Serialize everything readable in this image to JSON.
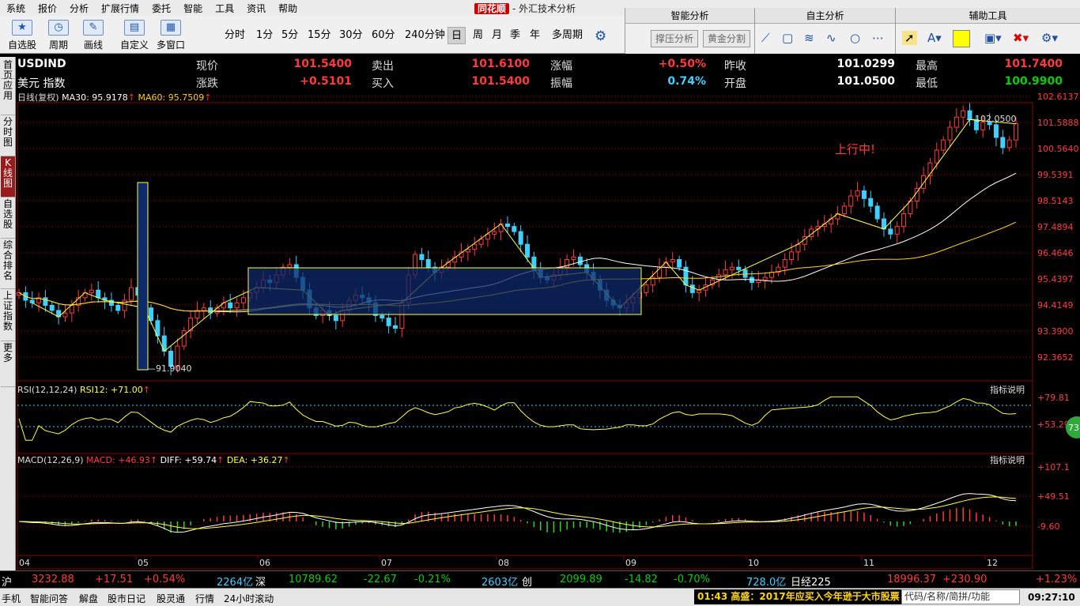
{
  "menu": [
    "系统",
    "报价",
    "分析",
    "扩展行情",
    "委托",
    "智能",
    "工具",
    "资讯",
    "帮助"
  ],
  "app_title": {
    "logo": "同花顺",
    "subtitle": "- 外汇技术分析"
  },
  "toolbar": {
    "buttons": [
      "自选股",
      "周期",
      "画线",
      "自定义",
      "多窗口"
    ],
    "periods": [
      "分时",
      "1分",
      "5分",
      "15分",
      "30分",
      "60分",
      "240分钟",
      "日",
      "周",
      "月",
      "季",
      "年",
      "多周期"
    ],
    "selected_period": "日"
  },
  "right_panels": {
    "smart": {
      "title": "智能分析",
      "btns": [
        "撑压分析",
        "黄金分割"
      ]
    },
    "self": {
      "title": "自主分析"
    },
    "aux": {
      "title": "辅助工具"
    }
  },
  "left_tabs": [
    "首页",
    "应用",
    "分时图",
    "K线图",
    "自选股",
    "综合排名",
    "上证指数",
    "更多"
  ],
  "selected_tab": "K线图",
  "quote": {
    "symbol": "USDIND",
    "name": "美元 指数",
    "rows": [
      [
        {
          "k": "现价",
          "v": "101.5400"
        },
        {
          "k": "卖出",
          "v": "101.6100"
        },
        {
          "k": "涨幅",
          "v": "+0.50%"
        },
        {
          "k": "昨收",
          "v": "101.0299"
        },
        {
          "k": "最高",
          "v": "101.7400"
        }
      ],
      [
        {
          "k": "涨跌",
          "v": "+0.5101"
        },
        {
          "k": "买入",
          "v": "101.5400"
        },
        {
          "k": "振幅",
          "v": "0.74%"
        },
        {
          "k": "开盘",
          "v": "101.0500"
        },
        {
          "k": "最低",
          "v": "100.9900"
        }
      ]
    ]
  },
  "chart_data": {
    "type": "candlestick",
    "header": {
      "label": "日线(复权)",
      "ma30": "MA30: 95.9178",
      "ma60": "MA60: 95.7509"
    },
    "price_ticks": [
      "102.6137",
      "101.5888",
      "100.5640",
      "99.5391",
      "98.5143",
      "97.4894",
      "96.4646",
      "95.4397",
      "94.4149",
      "93.3900",
      "92.3652"
    ],
    "ylim": [
      92.3652,
      102.6137
    ],
    "annotation": "上行中!",
    "high_label": "102.0500",
    "low_label": "91.9040",
    "x_labels": [
      "04",
      "05",
      "06",
      "07",
      "08",
      "09",
      "10",
      "11",
      "12"
    ],
    "rsi": {
      "label": "RSI(12,12,24)",
      "value": "RSI12: +71.00",
      "ticks": [
        "+79.81",
        "+53.29"
      ],
      "badge": "73"
    },
    "macd": {
      "label": "MACD(12,26,9)",
      "macd": "MACD: +46.93",
      "diff": "DIFF: +59.74",
      "dea": "DEA: +36.27",
      "ticks": [
        "+107.1",
        "+49.51",
        "-9.60"
      ]
    },
    "indicator_help": "指标说明",
    "closes": [
      94.9,
      94.6,
      94.5,
      94.7,
      94.4,
      94.2,
      93.95,
      94.1,
      94.4,
      94.7,
      94.9,
      95.0,
      94.7,
      94.6,
      94.4,
      94.2,
      94.6,
      95.1,
      94.8,
      94.3,
      93.8,
      93.2,
      92.6,
      92.0,
      92.8,
      93.4,
      93.9,
      94.2,
      94.3,
      94.1,
      94.3,
      94.5,
      94.3,
      94.5,
      94.7,
      94.9,
      95.1,
      95.4,
      95.3,
      95.6,
      95.9,
      96.0,
      95.5,
      95.0,
      94.3,
      94.0,
      94.2,
      94.0,
      93.8,
      94.2,
      94.6,
      94.8,
      94.7,
      94.5,
      94.0,
      93.9,
      93.6,
      93.5,
      94.5,
      95.6,
      96.4,
      96.2,
      95.9,
      95.7,
      95.9,
      96.1,
      96.3,
      96.5,
      96.6,
      96.8,
      97.0,
      97.2,
      97.3,
      97.6,
      97.5,
      97.3,
      96.8,
      96.3,
      95.8,
      95.5,
      95.4,
      95.6,
      95.9,
      96.2,
      96.3,
      96.0,
      95.7,
      95.4,
      95.0,
      94.6,
      94.4,
      94.3,
      94.5,
      94.7,
      94.9,
      95.2,
      95.5,
      95.9,
      96.1,
      96.2,
      95.9,
      95.2,
      94.9,
      95.0,
      95.2,
      95.4,
      95.6,
      95.8,
      95.9,
      95.8,
      95.5,
      95.3,
      95.4,
      95.5,
      95.7,
      95.9,
      96.2,
      96.5,
      96.8,
      97.1,
      97.4,
      97.5,
      97.6,
      97.8,
      98.0,
      98.3,
      98.7,
      98.9,
      98.6,
      98.3,
      97.8,
      97.4,
      97.2,
      97.5,
      98.0,
      98.5,
      99.0,
      99.5,
      100.0,
      100.5,
      100.9,
      101.4,
      101.8,
      102.05,
      101.7,
      101.3,
      101.6,
      101.5,
      101.0,
      100.6,
      100.9,
      101.54
    ]
  },
  "status": {
    "sh": "沪",
    "sh_val": "3232.88",
    "sh_chg": "+17.51",
    "sh_pct": "+0.54%",
    "sh_amt": "2264亿",
    "sz": "深",
    "sz_val": "10789.62",
    "sz_chg": "-22.67",
    "sz_pct": "-0.21%",
    "sz_amt": "2603亿",
    "cy": "创",
    "cy_val": "2099.89",
    "cy_chg": "-14.82",
    "cy_pct": "-0.70%",
    "cy_amt": "728.0亿",
    "nk": "日经225",
    "nk_val": "18996.37",
    "nk_chg": "+230.90",
    "nk_pct": "+1.23%"
  },
  "bottom": {
    "items": [
      "手机",
      "智能问答",
      "解盘",
      "股市日记",
      "股灵通",
      "行情",
      "24小时滚动"
    ],
    "ticker": "01:43 高盛：2017年应买入今年逊于大市股票",
    "search": "代码/名称/简拼/功能",
    "time": "09:27:10"
  }
}
